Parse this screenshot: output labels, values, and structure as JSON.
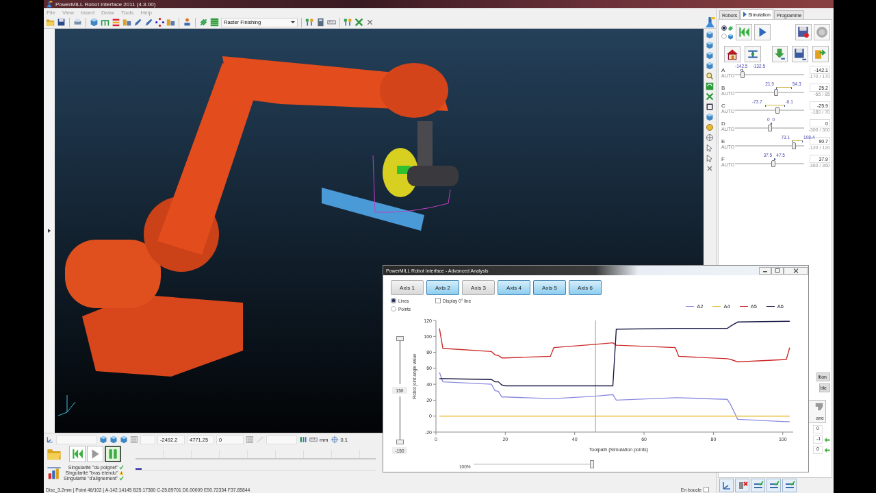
{
  "window": {
    "title": "PowerMILL Robot Interface 2011 (4.3.00)"
  },
  "menu": [
    "File",
    "View",
    "Insert",
    "Draw",
    "Tools",
    "Help"
  ],
  "toolbar": {
    "dropdown": "Raster Finishing"
  },
  "coords_bar": {
    "fields": [
      "-2492.2",
      "4771.25",
      "0"
    ],
    "unit": "mm",
    "tolerance": "0.1"
  },
  "playback": [
    {
      "kind": "rewind",
      "selected": false
    },
    {
      "kind": "play",
      "selected": false
    },
    {
      "kind": "pause",
      "selected": true
    }
  ],
  "singularities": [
    {
      "label": "Singularité \"du poignet\"",
      "kind": "ok"
    },
    {
      "label": "Singularité \"bras étendu\"",
      "kind": "warn"
    },
    {
      "label": "Singularité \"d'alignement\"",
      "kind": "ok"
    }
  ],
  "status_bar": "Disc_3.2mm | Point 46/102 | A-142.14145 B25.17380 C-25.89701 D0.00009 E90.72334 F37.85844",
  "loop": {
    "label": "En boucle",
    "checked": false
  },
  "right_panel": {
    "tabs": [
      {
        "label": "Robots",
        "selected": false
      },
      {
        "label": "Simulation",
        "selected": true
      },
      {
        "label": "Programme",
        "selected": false
      }
    ],
    "mode_radios": [
      {
        "selected": true
      },
      {
        "selected": false
      }
    ],
    "axes": [
      {
        "name": "A",
        "mode": "AUTO",
        "range_low": "-142.5",
        "range_high": "-132.5",
        "value": "-142.1",
        "limits": "-170 / 170",
        "level": 0.082
      },
      {
        "name": "B",
        "mode": "AUTO",
        "range_low": "21.9",
        "range_high": "54.3",
        "value": "25.2",
        "limits": "-65 / 85",
        "level": 0.601
      },
      {
        "name": "C",
        "mode": "AUTO",
        "range_low": "-73.7",
        "range_high": "-6.1",
        "value": "-25.9",
        "limits": "-180 / 70",
        "level": 0.616
      },
      {
        "name": "D",
        "mode": "AUTO",
        "range_low": "0",
        "range_high": "0",
        "value": "0",
        "limits": "-300 / 300",
        "level": 0.5
      },
      {
        "name": "E",
        "mode": "AUTO",
        "range_low": "73.1",
        "range_high": "108.4",
        "value": "90.7",
        "limits": "-120 / 120",
        "level": 0.878
      },
      {
        "name": "F",
        "mode": "AUTO",
        "range_low": "37.5",
        "range_high": "47.5",
        "value": "37.9",
        "limits": "-360 / 360",
        "level": 0.553
      }
    ],
    "partly_hidden": {
      "tabs": [
        "ition",
        "ble"
      ],
      "button": "ane",
      "fields": [
        "0",
        "-1",
        "0"
      ]
    }
  },
  "analysis": {
    "title": "PowerMILL Robot Interface - Advanced Analysis",
    "axis_buttons": [
      {
        "label": "Axis 1",
        "selected": false
      },
      {
        "label": "Axis 2",
        "selected": true
      },
      {
        "label": "Axis 3",
        "selected": false
      },
      {
        "label": "Axis 4",
        "selected": true
      },
      {
        "label": "Axis 5",
        "selected": true
      },
      {
        "label": "Axis 6",
        "selected": true
      }
    ],
    "display_mode": [
      {
        "label": "Lines",
        "selected": true
      },
      {
        "label": "Points",
        "selected": false
      }
    ],
    "zero_line": {
      "label": "Display 0° line",
      "checked": false
    },
    "scale_sliders": [
      {
        "value": "150",
        "level": 1
      },
      {
        "value": "-150",
        "level": 0
      }
    ],
    "zoom": {
      "label": "100%",
      "level": 1
    },
    "chart_data": {
      "type": "line",
      "xlabel": "Toolpath (Simulation points)",
      "ylabel": "Robot joint angle value",
      "x": [
        1,
        2,
        16,
        17,
        18,
        19,
        20,
        33,
        34,
        46,
        51,
        52,
        69,
        70,
        84,
        85,
        87,
        101,
        102
      ],
      "series": [
        {
          "name": "A2",
          "color": "#8c8ce0",
          "values": [
            55,
            43,
            40,
            32,
            31,
            24,
            24,
            22,
            22,
            25,
            27,
            20,
            23,
            23,
            21,
            14,
            -4,
            -7,
            -7
          ]
        },
        {
          "name": "A4",
          "color": "#e8c040",
          "values": [
            0,
            0,
            0,
            0,
            0,
            0,
            0,
            0,
            0,
            0,
            0,
            0,
            0,
            0,
            0,
            0,
            0,
            0,
            0
          ]
        },
        {
          "name": "A5",
          "color": "#cc2b2b",
          "values": [
            110,
            85,
            81,
            77,
            76,
            73,
            73,
            75,
            86,
            90,
            92,
            89,
            86,
            75,
            72,
            71,
            68,
            71,
            86
          ]
        },
        {
          "name": "A6",
          "color": "#1c1c48",
          "values": [
            47,
            47,
            46,
            43,
            43,
            39,
            38,
            38,
            38,
            38,
            38,
            109,
            110,
            110,
            110,
            113,
            118,
            119,
            119
          ]
        }
      ],
      "xlim": [
        0,
        103
      ],
      "ylim": [
        -20,
        120
      ],
      "xticks": [
        0,
        20,
        40,
        60,
        80,
        100
      ],
      "yticks": [
        -20,
        0,
        20,
        40,
        60,
        80,
        100,
        120
      ],
      "ref_lines": [
        {
          "axis": "x",
          "value": 46,
          "color": "#999999"
        }
      ]
    }
  }
}
